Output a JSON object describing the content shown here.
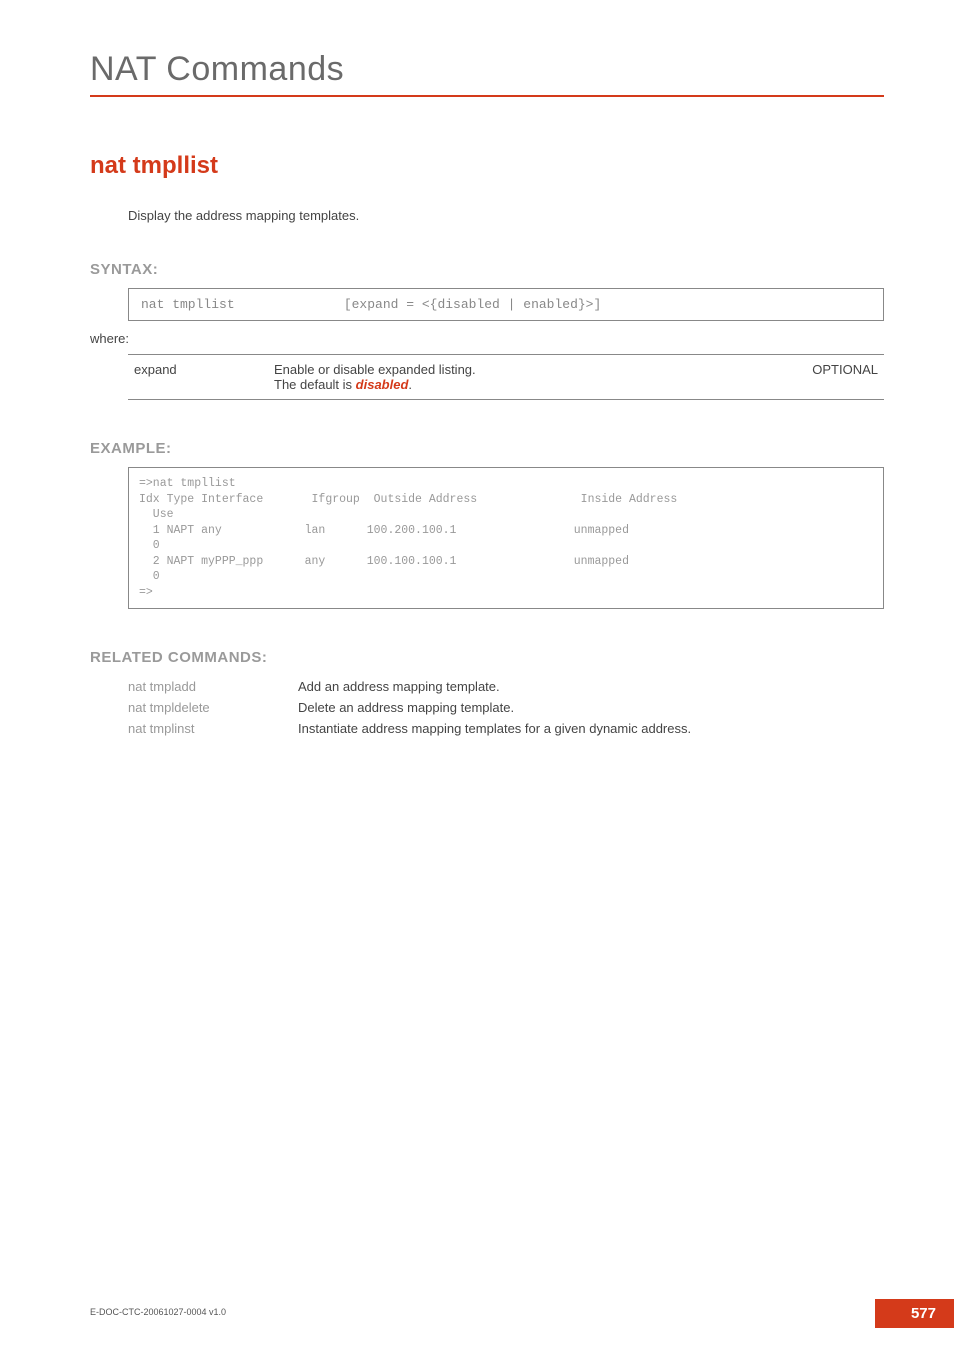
{
  "chapter": {
    "title": "NAT Commands"
  },
  "command": {
    "title": "nat tmpllist",
    "description": "Display the address mapping templates."
  },
  "syntax": {
    "heading": "SYNTAX:",
    "line": "nat tmpllist              [expand = <{disabled | enabled}>]",
    "where": "where:",
    "params": [
      {
        "name": "expand",
        "desc_prefix": "Enable or disable expanded listing.\nThe default is ",
        "desc_em": "disabled",
        "desc_suffix": ".",
        "opt": "OPTIONAL"
      }
    ]
  },
  "example": {
    "heading": "EXAMPLE:",
    "text": "=>nat tmpllist\nIdx Type Interface       Ifgroup  Outside Address               Inside Address\n  Use\n  1 NAPT any            lan      100.200.100.1                 unmapped\n  0\n  2 NAPT myPPP_ppp      any      100.100.100.1                 unmapped\n  0\n=>"
  },
  "related": {
    "heading": "RELATED COMMANDS:",
    "items": [
      {
        "cmd": "nat tmpladd",
        "desc": "Add an address mapping template."
      },
      {
        "cmd": "nat tmpldelete",
        "desc": "Delete an address mapping template."
      },
      {
        "cmd": "nat tmplinst",
        "desc": "Instantiate address mapping templates for a given dynamic address."
      }
    ]
  },
  "footer": {
    "docid": "E-DOC-CTC-20061027-0004 v1.0",
    "page": "577"
  }
}
